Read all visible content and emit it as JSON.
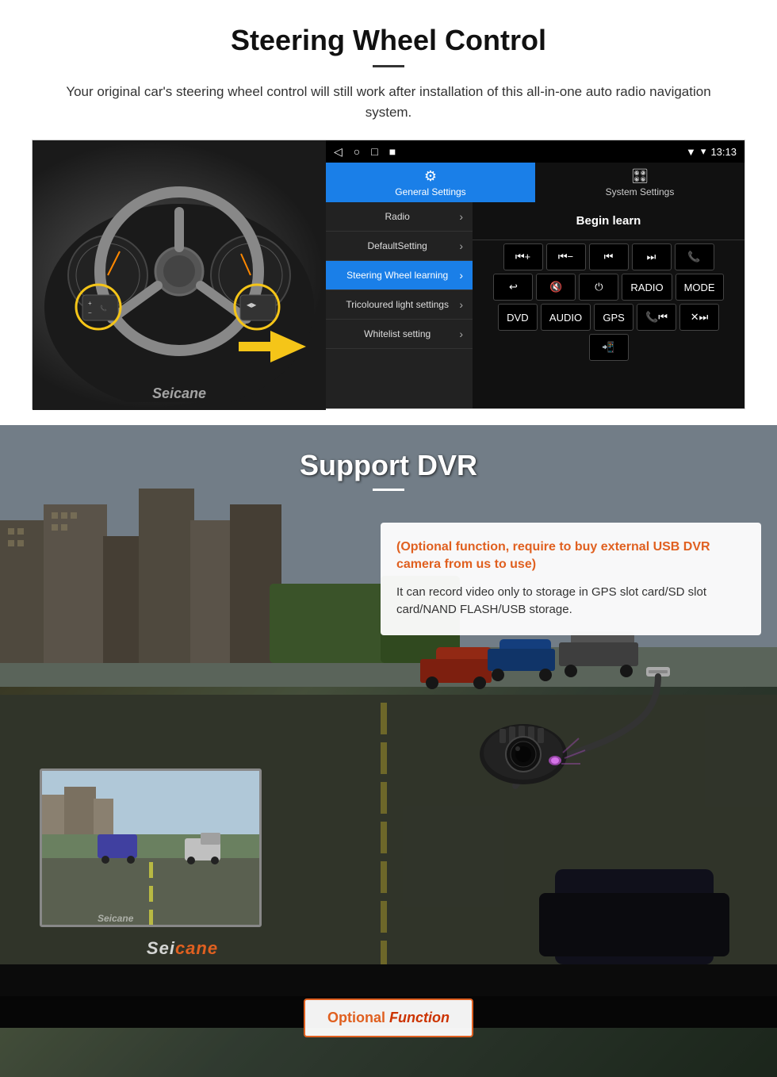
{
  "steering": {
    "title": "Steering Wheel Control",
    "description": "Your original car's steering wheel control will still work after installation of this all-in-one auto radio navigation system.",
    "statusbar": {
      "time": "13:13",
      "nav_icons": [
        "◁",
        "○",
        "□",
        "■"
      ]
    },
    "tabs": {
      "general": {
        "icon": "⚙",
        "label": "General Settings"
      },
      "system": {
        "icon": "🎛",
        "label": "System Settings"
      }
    },
    "menu_items": [
      {
        "label": "Radio",
        "active": false
      },
      {
        "label": "DefaultSetting",
        "active": false
      },
      {
        "label": "Steering Wheel learning",
        "active": true
      },
      {
        "label": "Tricoloured light settings",
        "active": false
      },
      {
        "label": "Whitelist setting",
        "active": false
      }
    ],
    "begin_learn": "Begin learn",
    "control_buttons": {
      "row1": [
        "⏮+",
        "⏮−",
        "⏮",
        "⏭",
        "📞"
      ],
      "row2": [
        "↩",
        "🔇×",
        "⏻",
        "RADIO",
        "MODE"
      ],
      "row3": [
        "DVD",
        "AUDIO",
        "GPS",
        "📞⏮",
        "✕⏭"
      ]
    }
  },
  "dvr": {
    "title": "Support DVR",
    "optional_text": "(Optional function, require to buy external USB DVR camera from us to use)",
    "description": "It can record video only to storage in GPS slot card/SD slot card/NAND FLASH/USB storage.",
    "optional_function_label": {
      "optional": "Optional",
      "function": "Function"
    }
  },
  "seicane_logo": "Seicane"
}
